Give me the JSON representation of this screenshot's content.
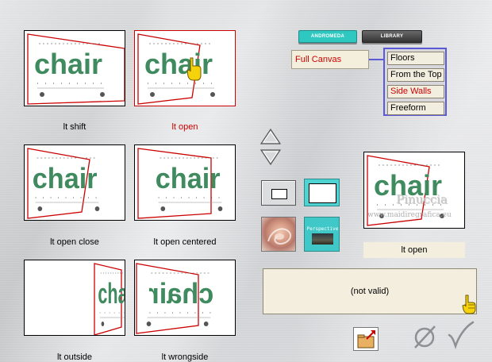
{
  "tabs": [
    {
      "label": "ANDROMEDA",
      "active": true
    },
    {
      "label": "LIBRARY",
      "active": false
    }
  ],
  "canvas_mode": "Full Canvas",
  "menu": {
    "items": [
      "Floors",
      "From the Top",
      "Side Walls",
      "Freeform"
    ],
    "selected_index": 2
  },
  "thumbnails": [
    {
      "caption": "lt shift",
      "selected": false
    },
    {
      "caption": "lt open",
      "selected": true
    },
    {
      "caption": "lt open close",
      "selected": false
    },
    {
      "caption": "lt open centered",
      "selected": false
    },
    {
      "caption": "lt outside",
      "selected": false
    },
    {
      "caption": "lt wrongside",
      "selected": false
    }
  ],
  "thumb_word": "chair",
  "preview": {
    "watermark_title": "Pinuccia",
    "watermark_url": "www.maidiregrafica.eu",
    "label": "lt open"
  },
  "perspective_label": "Perspective",
  "status_text": "(not valid)",
  "colors": {
    "accent_red": "#cc0000",
    "tab_active": "#2ec8c0",
    "menu_border": "#5a5ad8",
    "word_green": "#3f8a5e"
  },
  "icons": {
    "up": "triangle-up-icon",
    "down": "triangle-down-icon",
    "cancel": "null-sign-icon",
    "ok": "checkmark-icon",
    "pointer": "hand-pointer-icon",
    "open": "folder-open-icon"
  }
}
